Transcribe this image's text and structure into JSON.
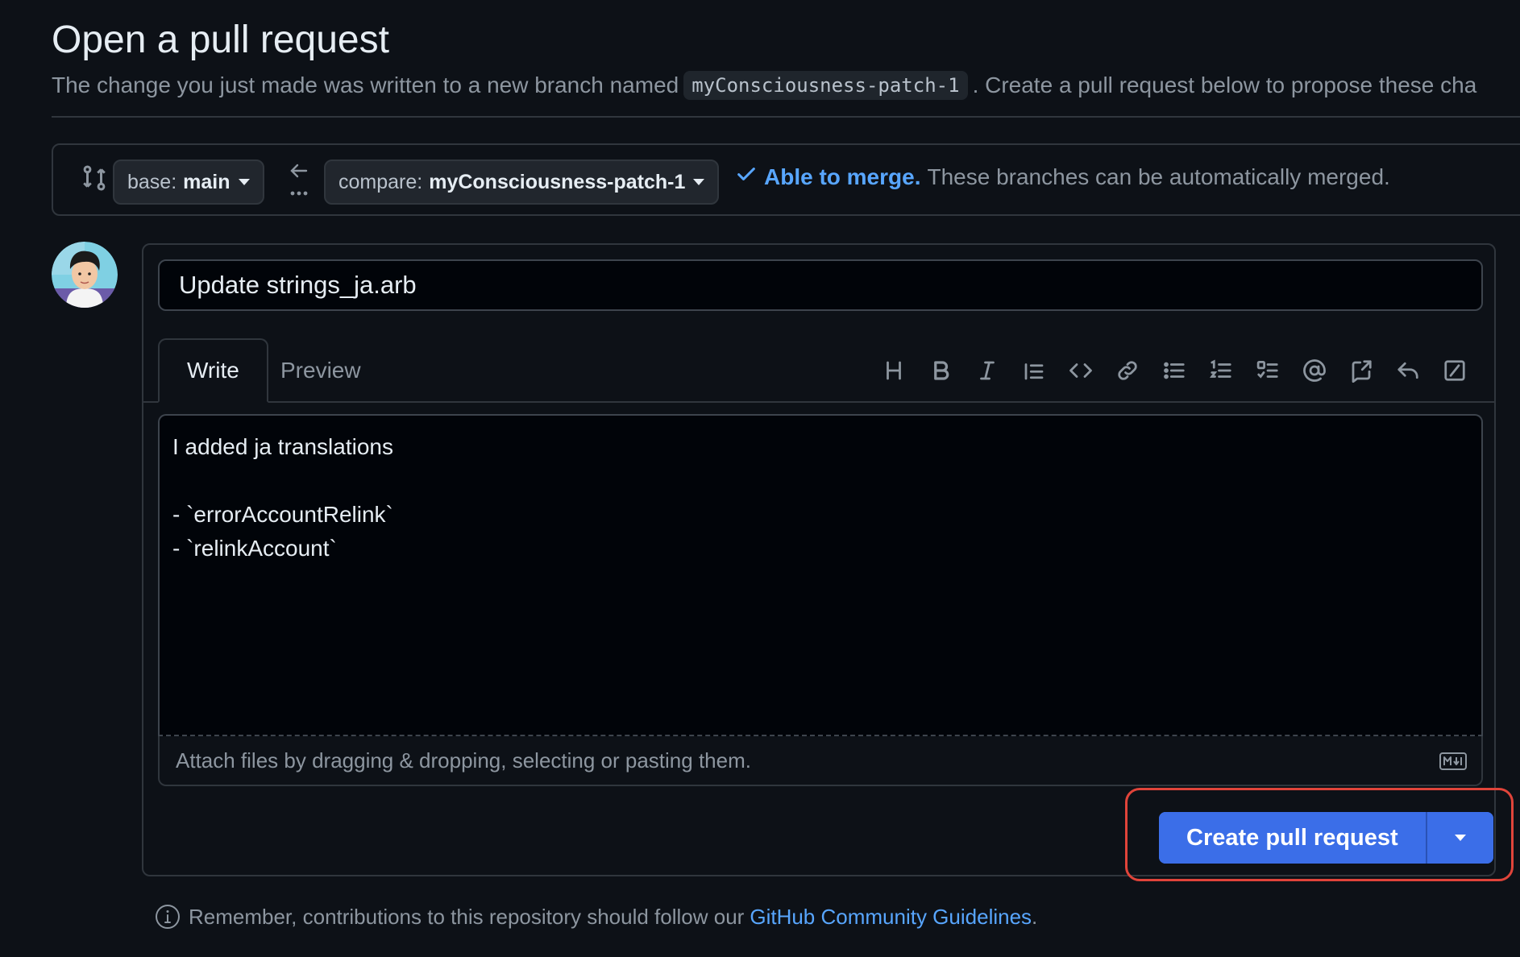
{
  "header": {
    "title": "Open a pull request",
    "subtitle_before": "The change you just made was written to a new branch named",
    "branch_name": "myConsciousness-patch-1",
    "subtitle_after": ". Create a pull request below to propose these cha"
  },
  "compare_bar": {
    "base_label": "base:",
    "base_value": "main",
    "compare_label": "compare:",
    "compare_value": "myConsciousness-patch-1",
    "merge_status": "Able to merge.",
    "merge_description": "These branches can be automatically merged."
  },
  "form": {
    "title_value": "Update strings_ja.arb",
    "tabs": [
      "Write",
      "Preview"
    ],
    "toolbar_icons": [
      "heading-icon",
      "bold-icon",
      "italic-icon",
      "quote-icon",
      "code-icon",
      "link-icon",
      "bulleted-list-icon",
      "numbered-list-icon",
      "task-list-icon",
      "mention-icon",
      "reference-icon",
      "reply-icon",
      "slash-command-icon"
    ],
    "body_lines": [
      "I added ja translations",
      "",
      "- `errorAccountRelink`",
      "- `relinkAccount`"
    ],
    "attach_hint": "Attach files by dragging & dropping, selecting or pasting them.",
    "create_button": "Create pull request"
  },
  "footer": {
    "note": "Remember, contributions to this repository should follow our",
    "link": "GitHub Community Guidelines",
    "period": "."
  },
  "colors": {
    "background": "#0d1117",
    "accent_link": "#58a6ff",
    "primary_button": "#3b6ee8",
    "highlight": "#e0443a"
  }
}
